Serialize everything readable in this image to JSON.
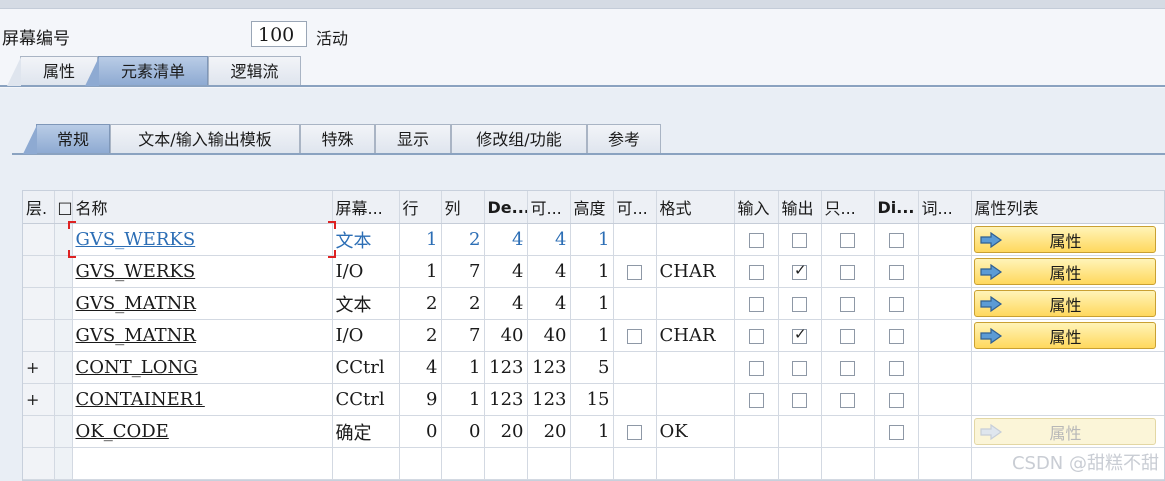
{
  "header": {
    "screen_label": "屏幕编号",
    "screen_number": "100",
    "status": "活动"
  },
  "main_tabs": [
    {
      "label": "属性",
      "active": false
    },
    {
      "label": "元素清单",
      "active": true
    },
    {
      "label": "逻辑流",
      "active": false
    }
  ],
  "sub_tabs": [
    {
      "label": "常规",
      "active": true
    },
    {
      "label": "文本/输入输出模板",
      "active": false
    },
    {
      "label": "特殊",
      "active": false
    },
    {
      "label": "显示",
      "active": false
    },
    {
      "label": "修改组/功能",
      "active": false
    },
    {
      "label": "参考",
      "active": false
    }
  ],
  "table": {
    "columns": [
      "层.",
      "□",
      "名称",
      "屏幕...",
      "行",
      "列",
      "De...",
      "可...",
      "高度",
      "可...",
      "格式",
      "输入",
      "输出",
      "只...",
      "Di...",
      "词...",
      "属性列表"
    ],
    "rows": [
      {
        "level": "",
        "name": "GVS_WERKS",
        "type": "文本",
        "row": "1",
        "col": "2",
        "def": "4",
        "vis": "4",
        "height": "1",
        "scroll": null,
        "format": "",
        "input": false,
        "output": false,
        "readonly": false,
        "dict": false,
        "attr": "属性",
        "attr_enabled": true,
        "selected": true
      },
      {
        "level": "",
        "name": "GVS_WERKS",
        "type": "I/O",
        "row": "1",
        "col": "7",
        "def": "4",
        "vis": "4",
        "height": "1",
        "scroll": false,
        "format": "CHAR",
        "input": false,
        "output": true,
        "readonly": false,
        "dict": false,
        "attr": "属性",
        "attr_enabled": true,
        "selected": false
      },
      {
        "level": "",
        "name": "GVS_MATNR",
        "type": "文本",
        "row": "2",
        "col": "2",
        "def": "4",
        "vis": "4",
        "height": "1",
        "scroll": null,
        "format": "",
        "input": false,
        "output": false,
        "readonly": false,
        "dict": false,
        "attr": "属性",
        "attr_enabled": true,
        "selected": false
      },
      {
        "level": "",
        "name": "GVS_MATNR",
        "type": "I/O",
        "row": "2",
        "col": "7",
        "def": "40",
        "vis": "40",
        "height": "1",
        "scroll": false,
        "format": "CHAR",
        "input": false,
        "output": true,
        "readonly": false,
        "dict": false,
        "attr": "属性",
        "attr_enabled": true,
        "selected": false
      },
      {
        "level": "+",
        "name": "CONT_LONG",
        "type": "CCtrl",
        "row": "4",
        "col": "1",
        "def": "123",
        "vis": "123",
        "height": "5",
        "scroll": null,
        "format": "",
        "input": false,
        "output": false,
        "readonly": false,
        "dict": false,
        "attr": "",
        "attr_enabled": false,
        "selected": false
      },
      {
        "level": "+",
        "name": "CONTAINER1",
        "type": "CCtrl",
        "row": "9",
        "col": "1",
        "def": "123",
        "vis": "123",
        "height": "15",
        "scroll": null,
        "format": "",
        "input": false,
        "output": false,
        "readonly": false,
        "dict": false,
        "attr": "",
        "attr_enabled": false,
        "selected": false
      },
      {
        "level": "",
        "name": "OK_CODE",
        "type": "确定",
        "row": "0",
        "col": "0",
        "def": "20",
        "vis": "20",
        "height": "1",
        "scroll": false,
        "format": "OK",
        "input": null,
        "output": null,
        "readonly": null,
        "dict": false,
        "attr": "属性",
        "attr_enabled": false,
        "selected": false
      }
    ]
  },
  "watermark": "CSDN @甜糕不甜",
  "colors": {
    "accent_tab": "#8eaad2",
    "button_yellow": "#ffd85e",
    "link_blue": "#2c6eb5"
  }
}
